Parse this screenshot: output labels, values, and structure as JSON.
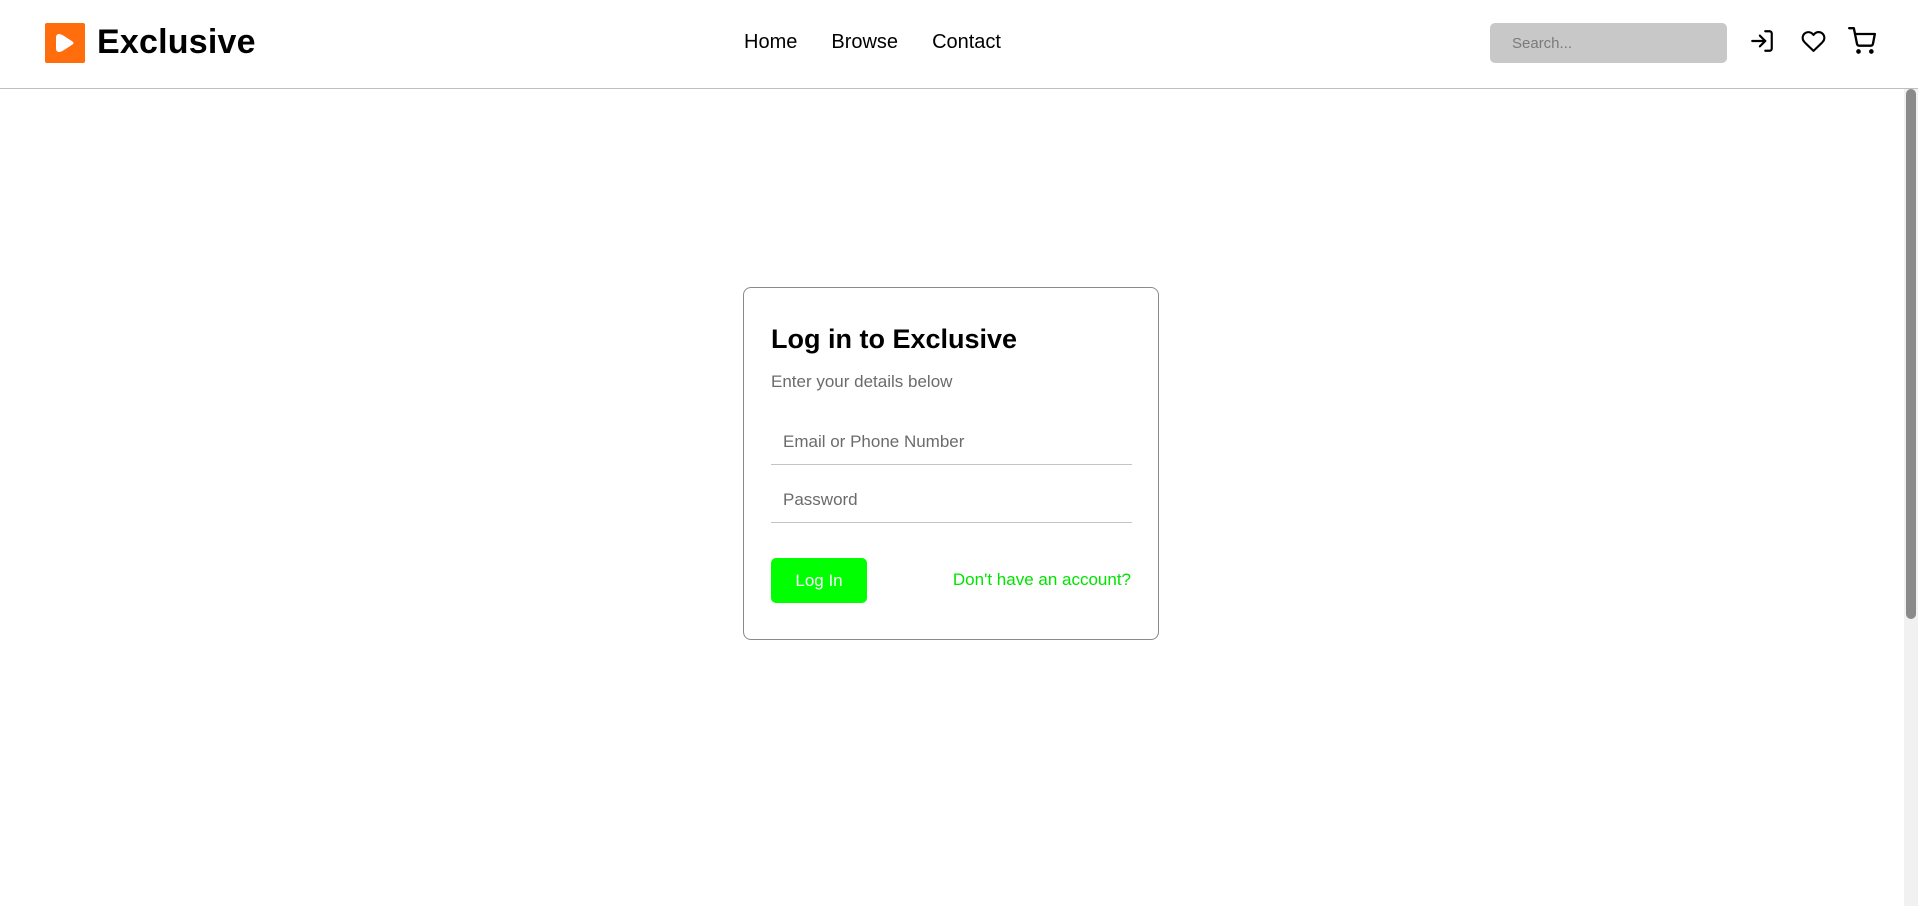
{
  "brand": {
    "name": "Exclusive",
    "logo_icon": "play-icon",
    "logo_color": "#ff6d0d"
  },
  "nav": {
    "items": [
      "Home",
      "Browse",
      "Contact"
    ]
  },
  "search": {
    "placeholder": "Search..."
  },
  "header_icons": [
    "login-icon",
    "heart-icon",
    "cart-icon"
  ],
  "login": {
    "title": "Log in to Exclusive",
    "subtitle": "Enter your details below",
    "email_placeholder": "Email or Phone Number",
    "password_placeholder": "Password",
    "button_label": "Log In",
    "signup_link": "Don't have an account?",
    "accent_color": "#00ff00"
  }
}
